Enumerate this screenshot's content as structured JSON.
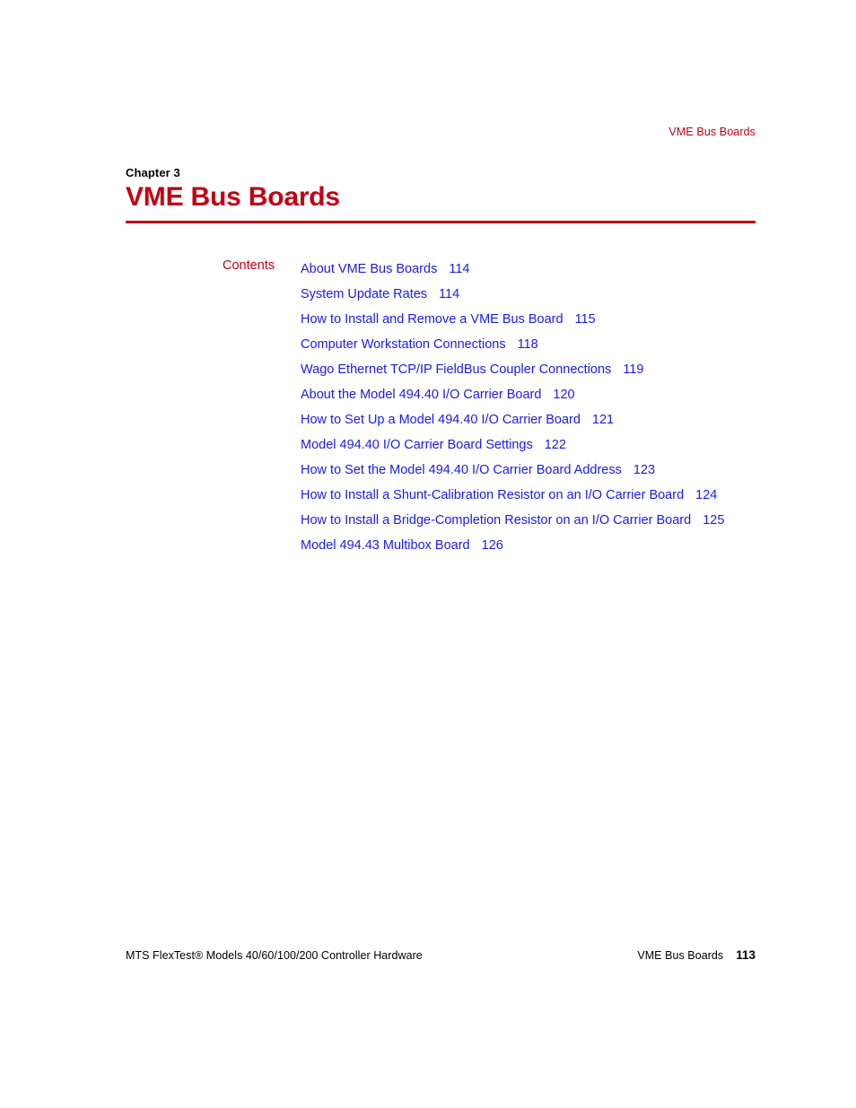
{
  "colors": {
    "accent_red": "#C00014",
    "link_blue": "#1A1AE6",
    "text_black": "#000000"
  },
  "running_header": {
    "text": "VME Bus Boards"
  },
  "chapter": {
    "label": "Chapter 3",
    "title": "VME Bus Boards"
  },
  "contents": {
    "label": "Contents",
    "entries": [
      {
        "title": "About VME Bus Boards",
        "page": "114"
      },
      {
        "title": "System Update Rates",
        "page": "114"
      },
      {
        "title": "How to Install and Remove a VME Bus Board",
        "page": "115"
      },
      {
        "title": "Computer Workstation Connections",
        "page": "118"
      },
      {
        "title": "Wago Ethernet TCP/IP FieldBus Coupler Connections",
        "page": "119"
      },
      {
        "title": "About the Model 494.40 I/O Carrier Board",
        "page": "120"
      },
      {
        "title": "How to Set Up a Model 494.40 I/O Carrier Board",
        "page": "121"
      },
      {
        "title": "Model 494.40 I/O Carrier Board Settings",
        "page": "122"
      },
      {
        "title": "How to Set the Model 494.40 I/O Carrier Board Address",
        "page": "123"
      },
      {
        "title": "How to Install a Shunt-Calibration Resistor on an I/O Carrier Board",
        "page": "124"
      },
      {
        "title": "How to Install a Bridge-Completion Resistor on an I/O Carrier Board",
        "page": "125"
      },
      {
        "title": "Model 494.43 Multibox Board",
        "page": "126"
      }
    ]
  },
  "footer": {
    "left": "MTS FlexTest® Models 40/60/100/200 Controller Hardware",
    "chapter": "VME Bus Boards",
    "page_number": "113"
  }
}
